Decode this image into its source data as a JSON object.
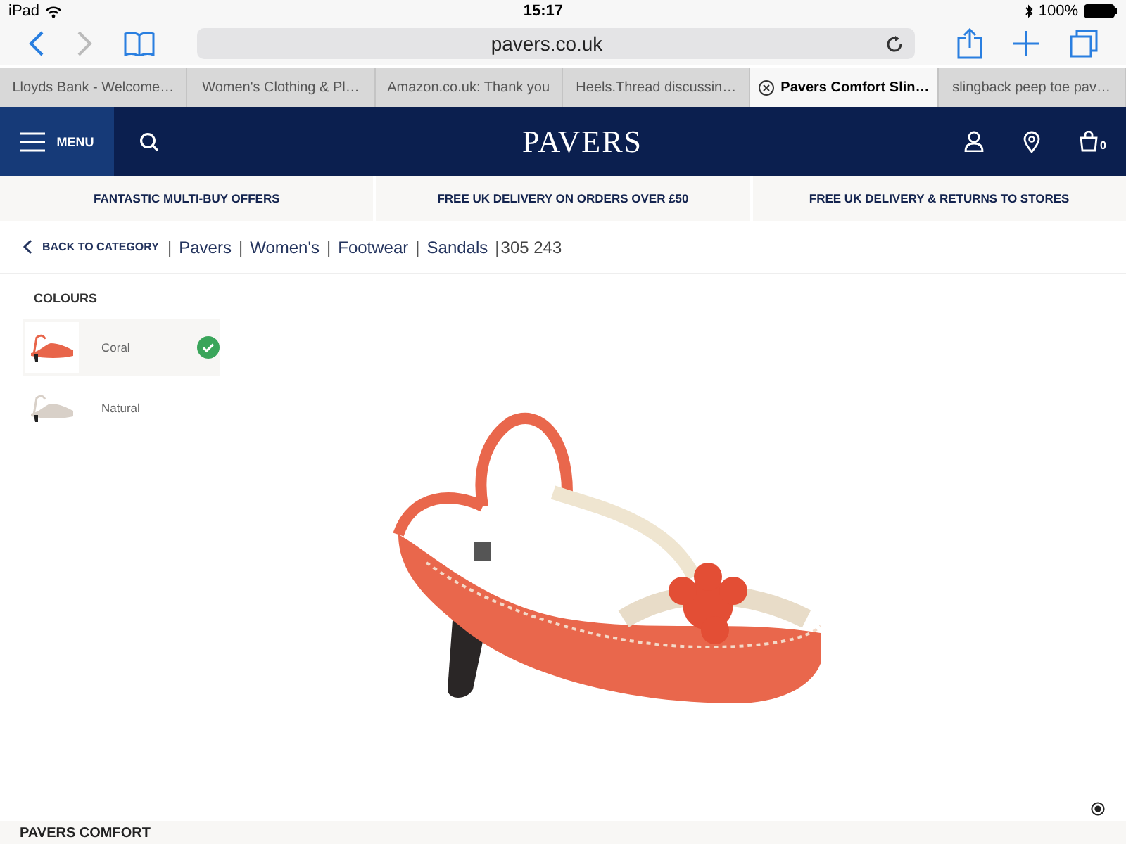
{
  "status_bar": {
    "device": "iPad",
    "time": "15:17",
    "battery": "100%"
  },
  "browser": {
    "address": "pavers.co.uk",
    "tabs": [
      {
        "title": "Lloyds Bank - Welcome…",
        "selected": false
      },
      {
        "title": "Women's Clothing & Pl…",
        "selected": false
      },
      {
        "title": "Amazon.co.uk: Thank you",
        "selected": false
      },
      {
        "title": "Heels.Thread discussin…",
        "selected": false
      },
      {
        "title": "Pavers Comfort Slin…",
        "selected": true
      },
      {
        "title": "slingback peep toe pav…",
        "selected": false
      }
    ]
  },
  "site_header": {
    "menu": "MENU",
    "logo": "PAVERS",
    "basket_count": "0"
  },
  "promos": [
    "FANTASTIC MULTI-BUY OFFERS",
    "FREE UK DELIVERY ON ORDERS OVER £50",
    "FREE UK DELIVERY & RETURNS TO STORES"
  ],
  "breadcrumb": {
    "back": "BACK TO CATEGORY",
    "items": [
      "Pavers",
      "Women's",
      "Footwear",
      "Sandals"
    ],
    "code": "305 243",
    "separator": "|"
  },
  "colours": {
    "heading": "COLOURS",
    "options": [
      {
        "name": "Coral",
        "selected": true,
        "color": "#e8654a"
      },
      {
        "name": "Natural",
        "selected": false,
        "color": "#d8d0c8"
      }
    ]
  },
  "footer_strip": {
    "heading": "PAVERS COMFORT"
  }
}
